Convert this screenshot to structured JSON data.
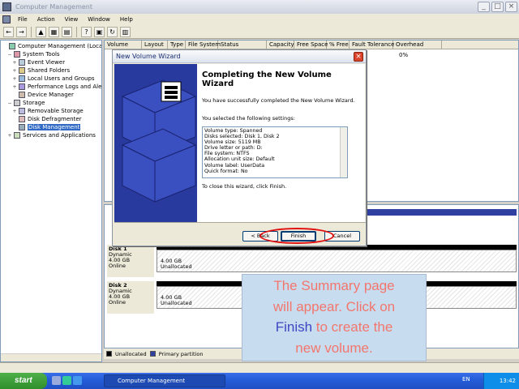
{
  "window": {
    "title": "Computer Management"
  },
  "menu": {
    "items": [
      "File",
      "Action",
      "View",
      "Window",
      "Help"
    ]
  },
  "tree": {
    "items": [
      {
        "label": "Computer Management (Local)",
        "indent": 0,
        "exp": ""
      },
      {
        "label": "System Tools",
        "indent": 1,
        "exp": "−"
      },
      {
        "label": "Event Viewer",
        "indent": 2,
        "exp": "+"
      },
      {
        "label": "Shared Folders",
        "indent": 2,
        "exp": "+"
      },
      {
        "label": "Local Users and Groups",
        "indent": 2,
        "exp": "+"
      },
      {
        "label": "Performance Logs and Alerts",
        "indent": 2,
        "exp": "+"
      },
      {
        "label": "Device Manager",
        "indent": 2,
        "exp": ""
      },
      {
        "label": "Storage",
        "indent": 1,
        "exp": "−"
      },
      {
        "label": "Removable Storage",
        "indent": 2,
        "exp": "+"
      },
      {
        "label": "Disk Defragmenter",
        "indent": 2,
        "exp": ""
      },
      {
        "label": "Disk Management",
        "indent": 2,
        "exp": "",
        "selected": true
      },
      {
        "label": "Services and Applications",
        "indent": 1,
        "exp": "+"
      }
    ]
  },
  "columns": [
    "Volume",
    "Layout",
    "Type",
    "File System",
    "Status",
    "Capacity",
    "Free Space",
    "% Free",
    "Fault Tolerance",
    "Overhead"
  ],
  "list": {
    "overhead_value": "0%"
  },
  "disks": [
    {
      "name": "Disk 1",
      "type": "Dynamic",
      "size": "4.00 GB",
      "state": "Online",
      "part_size": "4.00 GB",
      "part_label": "Unallocated"
    },
    {
      "name": "Disk 2",
      "type": "Dynamic",
      "size": "4.00 GB",
      "state": "Online",
      "part_size": "4.00 GB",
      "part_label": "Unallocated"
    }
  ],
  "legend": {
    "unallocated": "Unallocated",
    "primary": "Primary partition"
  },
  "dialog": {
    "title": "New Volume Wizard",
    "heading": "Completing the New Volume Wizard",
    "success_text": "You have successfully completed the New Volume Wizard.",
    "settings_intro": "You selected the following settings:",
    "summary_lines": [
      "Volume type: Spanned",
      "Disks selected: Disk 1, Disk 2",
      "Volume size: 5119 MB",
      "Drive letter or path: D:",
      "File system: NTFS",
      "Allocation unit size: Default",
      "Volume label: UserData",
      "Quick format: No"
    ],
    "close_text": "To close this wizard, click Finish.",
    "back_label": "< Back",
    "finish_label": "Finish",
    "cancel_label": "Cancel"
  },
  "callout": {
    "line1": "The Summary page",
    "line2": "will appear. Click on",
    "highlight": "Finish",
    "line3_rest": " to create the",
    "line4": "new volume."
  },
  "taskbar": {
    "start_label": "start",
    "task_label": "Computer Management",
    "lang": "EN",
    "clock": "13:42"
  },
  "colors": {
    "accent_blue": "#3f46c4",
    "callout_text": "#f2766c",
    "callout_bg": "#c8dcf0",
    "ring": "#e01010"
  }
}
